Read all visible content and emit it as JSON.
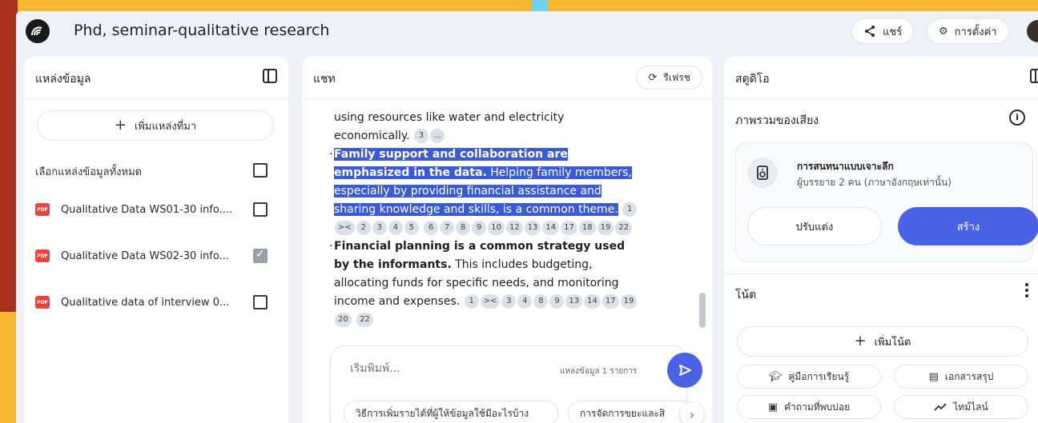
{
  "header": {
    "notebook_title": "Phd, seminar-qualitative research",
    "share_label": "แชร์",
    "settings_label": "การตั้งค่า"
  },
  "sources": {
    "title": "แหล่งข้อมูล",
    "add_label": "เพิ่มแหล่งที่มา",
    "select_all_label": "เลือกแหล่งข้อมูลทั้งหมด",
    "select_all_checked": false,
    "items": [
      {
        "type": "PDF",
        "label": "Qualitative Data WS01-30 info....",
        "checked": false
      },
      {
        "type": "PDF",
        "label": "Qualitative Data WS02-30 info...",
        "checked": true
      },
      {
        "type": "PDF",
        "label": "Qualitative data of interview 0...",
        "checked": false
      }
    ]
  },
  "chat": {
    "title": "แชท",
    "refresh_label": "รีเฟรช",
    "line1": "using resources like water and electricity economically.",
    "line1_cites": [
      "3",
      "..."
    ],
    "para2_bold": "Family support and collaboration are emphasized in the data.",
    "para2_text": " Helping family members, especially by providing financial assistance and sharing knowledge and skills, is a common theme.",
    "para2_cites": [
      "1",
      "><",
      "2",
      "3",
      "4",
      "5",
      "6",
      "7",
      "8",
      "9",
      "10",
      "12",
      "13",
      "14",
      "17",
      "18",
      "19",
      "22"
    ],
    "para3_bold": "Financial planning is a common strategy used by the informants.",
    "para3_text": " This includes budgeting, allocating funds for specific needs, and monitoring income and expenses.",
    "para3_cites": [
      "1",
      "><",
      "3",
      "4",
      "8",
      "9",
      "13",
      "14",
      "17",
      "19",
      "20",
      "22"
    ],
    "input_placeholder": "เริ่มพิมพ์...",
    "source_count": "แหล่งข้อมูล 1 รายการ",
    "suggestions": [
      "วิธีการเพิ่มรายได้ที่ผู้ให้ข้อมูลใช้มีอะไรบ้าง",
      "การจัดการขยะและสิ"
    ]
  },
  "studio": {
    "title": "สตูดิโอ",
    "overview_title": "ภาพรวมของเสียง",
    "audio_title": "การสนทนาแบบเจาะลึก",
    "audio_subtitle": "ผู้บรรยาย 2 คน (ภาษาอังกฤษเท่านั้น)",
    "customize_label": "ปรับแต่ง",
    "create_label": "สร้าง",
    "notes_title": "โน้ต",
    "add_note_label": "เพิ่มโน้ต",
    "note_chips": {
      "study_guide": "คู่มือการเรียนรู้",
      "briefing": "เอกสารสรุป",
      "faq": "คำถามที่พบบ่อย",
      "timeline": "ไทม์ไลน์"
    }
  },
  "colors": {
    "background_frame": "#f7b731",
    "accent": "#4a63e6",
    "highlight": "#3b5bd6",
    "pdf_icon": "#e8453c"
  }
}
